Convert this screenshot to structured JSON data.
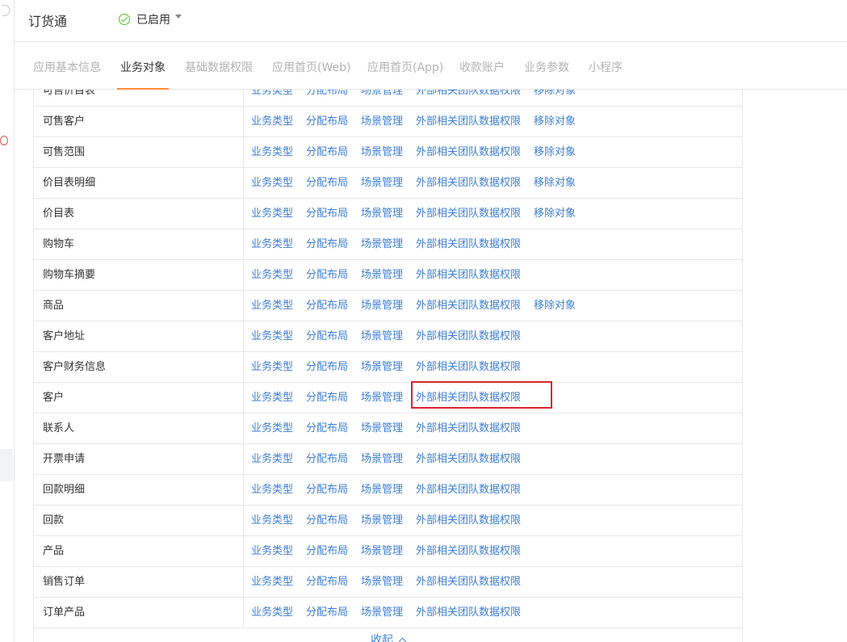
{
  "app": {
    "title": "订货通",
    "status": "已启用"
  },
  "tabs": [
    {
      "label": "应用基本信息"
    },
    {
      "label": "业务对象"
    },
    {
      "label": "基础数据权限"
    },
    {
      "label": "应用首页(Web)"
    },
    {
      "label": "应用首页(App)"
    },
    {
      "label": "收款账户"
    },
    {
      "label": "业务参数"
    },
    {
      "label": "小程序"
    }
  ],
  "active_tab": "业务对象",
  "actions": {
    "biz_type": "业务类型",
    "layout": "分配布局",
    "scene": "场景管理",
    "ext_permission": "外部相关团队数据权限",
    "remove": "移除对象"
  },
  "rows": [
    {
      "name": "可售价目表",
      "removable": true
    },
    {
      "name": "可售客户",
      "removable": true
    },
    {
      "name": "可售范围",
      "removable": true
    },
    {
      "name": "价目表明细",
      "removable": true
    },
    {
      "name": "价目表",
      "removable": true
    },
    {
      "name": "购物车",
      "removable": false
    },
    {
      "name": "购物车摘要",
      "removable": false
    },
    {
      "name": "商品",
      "removable": true
    },
    {
      "name": "客户地址",
      "removable": false
    },
    {
      "name": "客户财务信息",
      "removable": false
    },
    {
      "name": "客户",
      "removable": false,
      "highlighted": true
    },
    {
      "name": "联系人",
      "removable": false
    },
    {
      "name": "开票申请",
      "removable": false
    },
    {
      "name": "回款明细",
      "removable": false
    },
    {
      "name": "回款",
      "removable": false
    },
    {
      "name": "产品",
      "removable": false
    },
    {
      "name": "销售订单",
      "removable": false
    },
    {
      "name": "订单产品",
      "removable": false
    }
  ],
  "collapse_label": "收起",
  "colors": {
    "link": "#3d7fd8",
    "tab_active_underline": "#ff8b3d",
    "highlight": "#d9232b",
    "enabled": "#52c41a"
  }
}
